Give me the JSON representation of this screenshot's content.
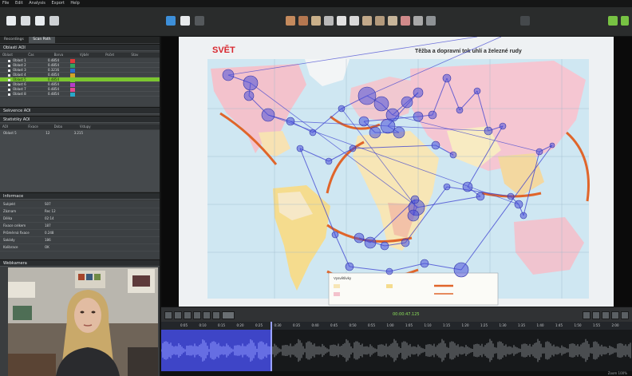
{
  "menu": [
    "File",
    "Edit",
    "Analysis",
    "Export",
    "Help"
  ],
  "toolbar": {
    "left_icons": [
      "new-icon",
      "open-icon",
      "save-icon",
      "print-icon"
    ],
    "center_icons": [
      "aoi-rect-icon",
      "aoi-ellipse-icon",
      "aoi-polygon-icon",
      "aoi-move-icon",
      "pointer-icon",
      "cursor-icon",
      "select-icon",
      "grid-icon",
      "heatmap-icon",
      "gazeplot-icon",
      "sync-icon",
      "settings-icon"
    ],
    "right_icons": [
      "camera-icon",
      "prev-icon",
      "next-icon"
    ]
  },
  "sidebar": {
    "tabs": [
      {
        "label": "Recordings",
        "active": false
      },
      {
        "label": "Scan Path",
        "active": true
      }
    ],
    "aoi_panel": {
      "title": "Oblasti AOI",
      "columns": [
        "Oblast",
        "Čas",
        "Barva",
        "Výběr",
        "Počet",
        "Stav"
      ],
      "rows": [
        {
          "name": "Oblast 1",
          "value": "0.4854",
          "color": "#e03a3a",
          "selected": false
        },
        {
          "name": "Oblast 2",
          "value": "0.4854",
          "color": "#31a35f",
          "selected": false
        },
        {
          "name": "Oblast 3",
          "value": "0.3216",
          "color": "#2a6cc9",
          "selected": false
        },
        {
          "name": "Oblast 4",
          "value": "0.4854",
          "color": "#d0a42a",
          "selected": false
        },
        {
          "name": "Oblast 5",
          "value": "0.4854",
          "color": "#7bc630",
          "selected": true
        },
        {
          "name": "Oblast 6",
          "value": "0.4854",
          "color": "#b83cc8",
          "selected": false
        },
        {
          "name": "Oblast 7",
          "value": "0.4854",
          "color": "#e44a8d",
          "selected": false
        },
        {
          "name": "Oblast 8",
          "value": "0.4854",
          "color": "#2aa7c9",
          "selected": false
        }
      ]
    },
    "seq_panel": {
      "title": "Sekvence AOI"
    },
    "stats_panel": {
      "title": "Statistiky AOI",
      "columns": [
        "AOI",
        "Fixace",
        "Doba",
        "Vstupy"
      ],
      "rows": [
        {
          "aoi": "Oblast 5",
          "fix": "12",
          "dur": "3.215"
        }
      ]
    },
    "info_panel": {
      "title": "Informace",
      "fields": [
        {
          "k": "Subjekt",
          "v": "S07"
        },
        {
          "k": "Záznam",
          "v": "Rec 12"
        },
        {
          "k": "Délka",
          "v": "02:14"
        },
        {
          "k": "Fixace celkem",
          "v": "187"
        },
        {
          "k": "Průměrná fixace",
          "v": "0.248"
        },
        {
          "k": "Sakády",
          "v": "186"
        },
        {
          "k": "Kalibrace",
          "v": "OK"
        }
      ]
    },
    "webcam_title": "Webkamera"
  },
  "map": {
    "title_left": "SVĚT",
    "title_right": "Těžba a dopravní tok uhlí a železné rudy",
    "legend_label": "Vysvětlivky"
  },
  "timeline": {
    "time_label": "00:00:47.125",
    "ruler_ticks": [
      "0:05",
      "0:10",
      "0:15",
      "0:20",
      "0:25",
      "0:30",
      "0:35",
      "0:40",
      "0:45",
      "0:50",
      "0:55",
      "1:00",
      "1:05",
      "1:10",
      "1:15",
      "1:20",
      "1:25",
      "1:30",
      "1:35",
      "1:40",
      "1:45",
      "1:50",
      "1:55",
      "2:00"
    ],
    "progress": 0.234
  },
  "status": {
    "text": "Zoom 100%"
  },
  "colors": {
    "accent_green": "#7bc630",
    "gaze_blue": "#3b3fd0",
    "timeline_blue": "#3e45c7",
    "panel_bg": "#3a3d3f"
  }
}
